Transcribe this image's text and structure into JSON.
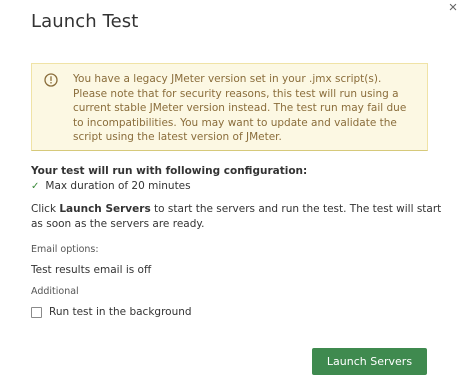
{
  "dialog": {
    "title": "Launch Test",
    "close_glyph": "×"
  },
  "warning": {
    "icon": "exclamation-circle-icon",
    "message": "You have a legacy JMeter version set in your .jmx script(s). Please note that for security reasons, this test will run using a current stable JMeter version instead. The test run may fail due to incompatibilities. You may want to update and validate the script using the latest version of JMeter.",
    "text_color": "#8a6d3b",
    "background": "#fcf8e3"
  },
  "configuration": {
    "heading": "Your test will run with following configuration:",
    "items": [
      "Max duration of 20 minutes"
    ],
    "check_glyph": "✓"
  },
  "launch_info": {
    "prefix": "Click ",
    "emphasis": "Launch Servers",
    "suffix": " to start the servers and run the test. The test will start as soon as the servers are ready."
  },
  "email": {
    "label": "Email options:",
    "value": "Test results email is off"
  },
  "additional": {
    "label": "Additional",
    "background_option_label": "Run test in the background",
    "background_option_checked": false
  },
  "actions": {
    "launch_label": "Launch Servers",
    "launch_color": "#3f8a4f"
  }
}
